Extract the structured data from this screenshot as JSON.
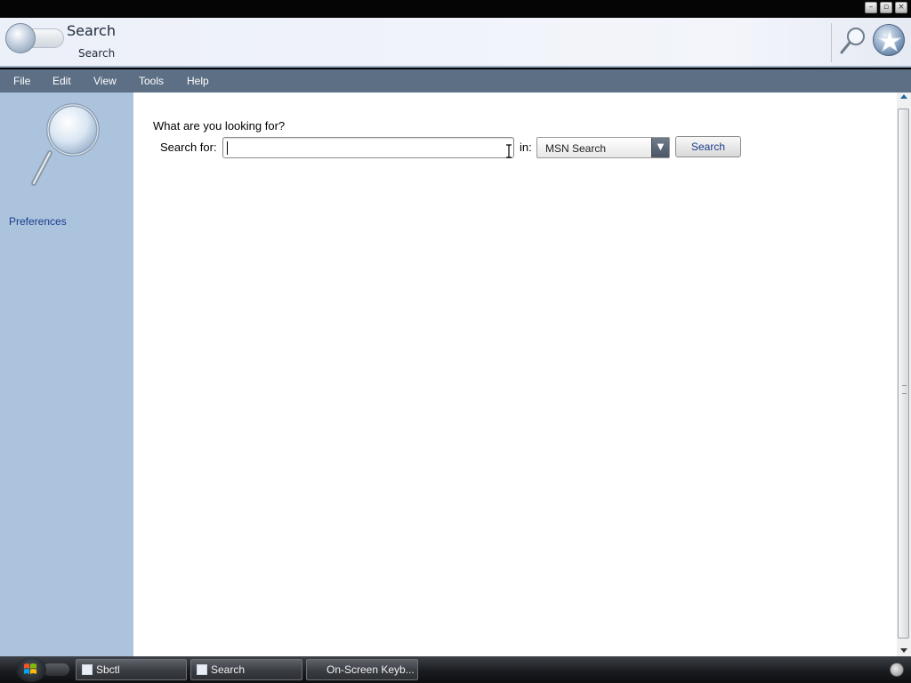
{
  "window": {
    "controls": [
      {
        "name": "minimize",
        "glyph": "–"
      },
      {
        "name": "maximize",
        "glyph": "▫"
      },
      {
        "name": "close",
        "glyph": "×"
      }
    ]
  },
  "header": {
    "title": "Search",
    "subtitle": "Search"
  },
  "menu": {
    "items": [
      "File",
      "Edit",
      "View",
      "Tools",
      "Help"
    ]
  },
  "sidebar": {
    "preferences_label": "Preferences"
  },
  "search": {
    "prompt": "What are you looking for?",
    "search_for_label": "Search for:",
    "query_value": "",
    "in_label": "in:",
    "provider_selected": "MSN Search",
    "button_label": "Search"
  },
  "taskbar": {
    "items": [
      {
        "label": "Sbctl",
        "icon": "window-icon"
      },
      {
        "label": "Search",
        "icon": "document-icon"
      },
      {
        "label": "On-Screen Keyb...",
        "icon": ""
      }
    ]
  },
  "colors": {
    "menubar": "#5c6f84",
    "sidebar": "#abc3dd",
    "link": "#1a3c8c"
  }
}
